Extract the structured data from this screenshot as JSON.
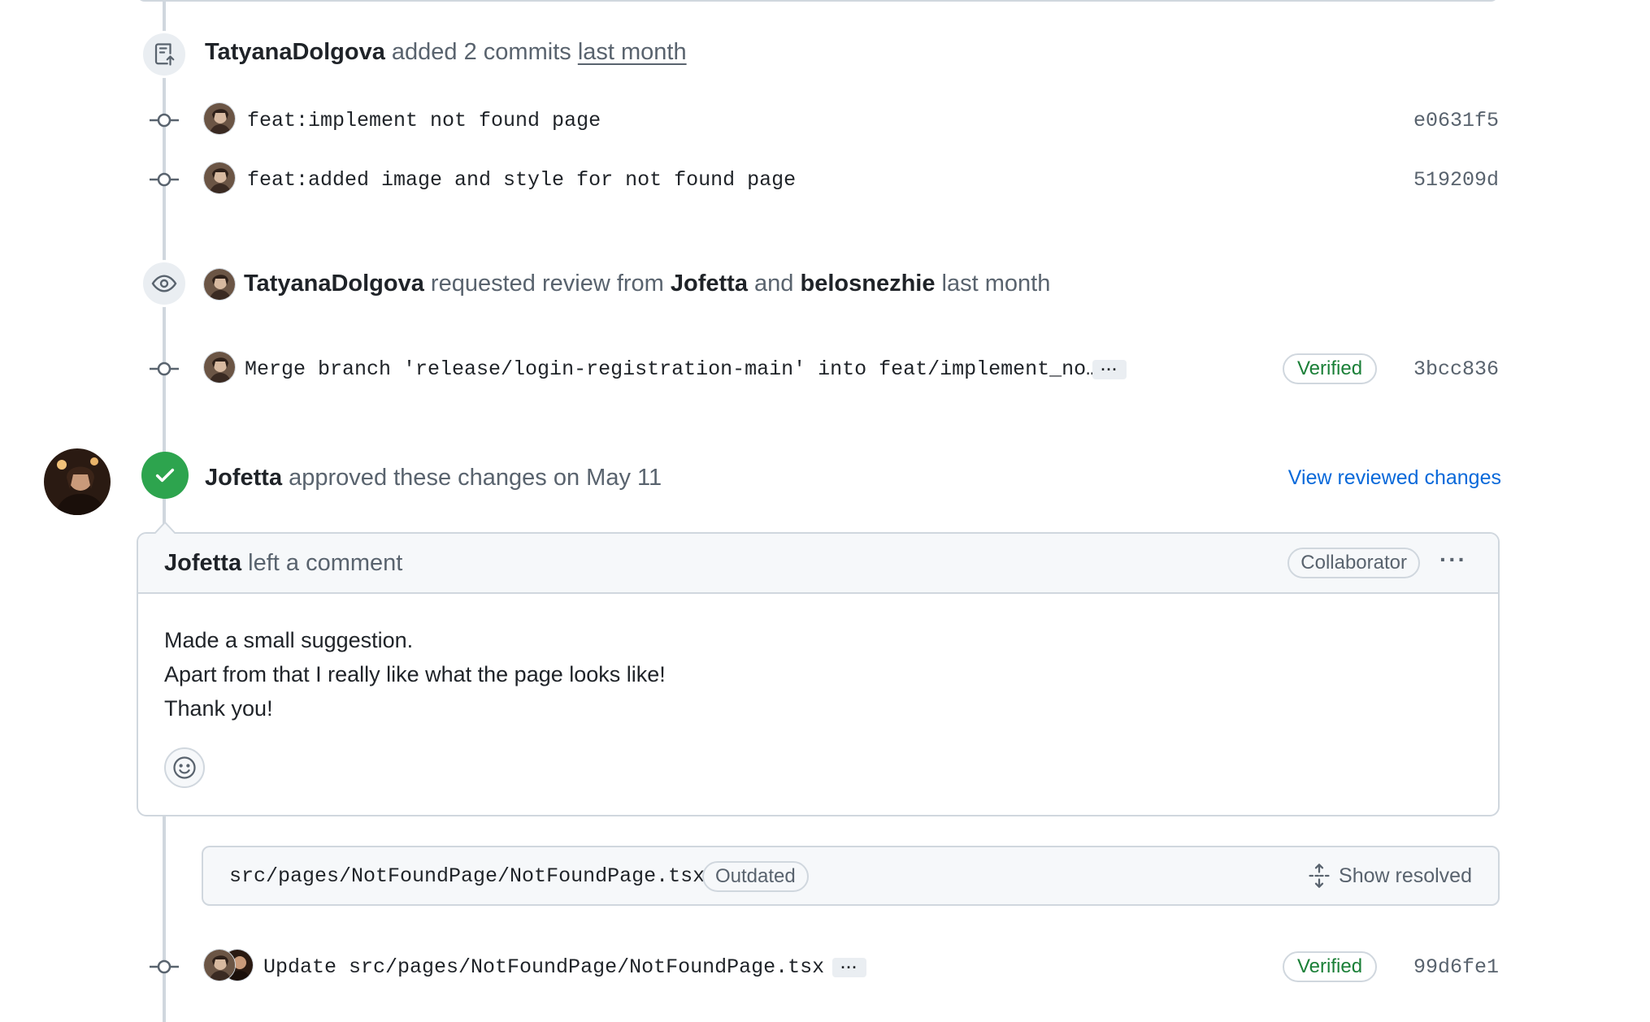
{
  "commits_event": {
    "author": "TatyanaDolgova",
    "action": "added 2 commits",
    "time": "last month"
  },
  "commits": [
    {
      "message": "feat:implement not found page",
      "sha": "e0631f5"
    },
    {
      "message": "feat:added image and style for not found page",
      "sha": "519209d"
    }
  ],
  "review_request": {
    "author": "TatyanaDolgova",
    "action": "requested review from",
    "reviewer1": "Jofetta",
    "conj": "and",
    "reviewer2": "belosnezhie",
    "time": "last month"
  },
  "merge_commit": {
    "message": "Merge branch 'release/login-registration-main' into feat/implement_no…",
    "ellipsis": "···",
    "verified": "Verified",
    "sha": "3bcc836"
  },
  "approval": {
    "reviewer": "Jofetta",
    "action": "approved these changes",
    "time": "on May 11",
    "view_link": "View reviewed changes"
  },
  "review_comment": {
    "author": "Jofetta",
    "action": "left a comment",
    "role": "Collaborator",
    "more": "···",
    "lines": [
      "Made a small suggestion.",
      "Apart from that I really like what the page looks like!",
      "Thank you!"
    ]
  },
  "file_thread": {
    "path": "src/pages/NotFoundPage/NotFoundPage.tsx",
    "status": "Outdated",
    "show_resolved": "Show resolved"
  },
  "update_commit": {
    "message": "Update src/pages/NotFoundPage/NotFoundPage.tsx",
    "ellipsis": "···",
    "verified": "Verified",
    "sha": "99d6fe1"
  },
  "colors": {
    "approved_green": "#2da44e",
    "verified_green": "#1a7f37",
    "link_blue": "#0969da",
    "border": "#d0d7de",
    "muted": "#59636e"
  }
}
